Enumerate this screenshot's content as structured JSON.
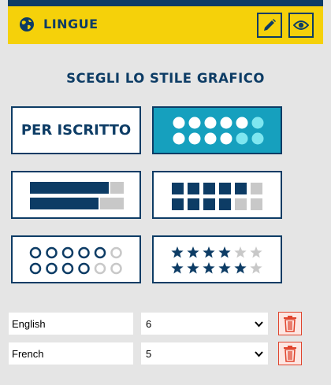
{
  "header": {
    "title": "LINGUE",
    "globe_icon": "globe-icon",
    "edit_icon": "pencil-icon",
    "view_icon": "eye-icon"
  },
  "section": {
    "title": "SCEGLI LO STILE GRAFICO"
  },
  "styles": {
    "text_option_label": "PER ISCRITTO",
    "selected_option": "dots"
  },
  "languages": [
    {
      "name": "English",
      "level": "6"
    },
    {
      "name": "French",
      "level": "5"
    }
  ],
  "colors": {
    "navy": "#0d3c65",
    "yellow": "#f5d10a",
    "teal": "#16a0be",
    "light_teal": "#7ee6f0",
    "grey": "#c8c8c8",
    "danger": "#e0442d"
  }
}
